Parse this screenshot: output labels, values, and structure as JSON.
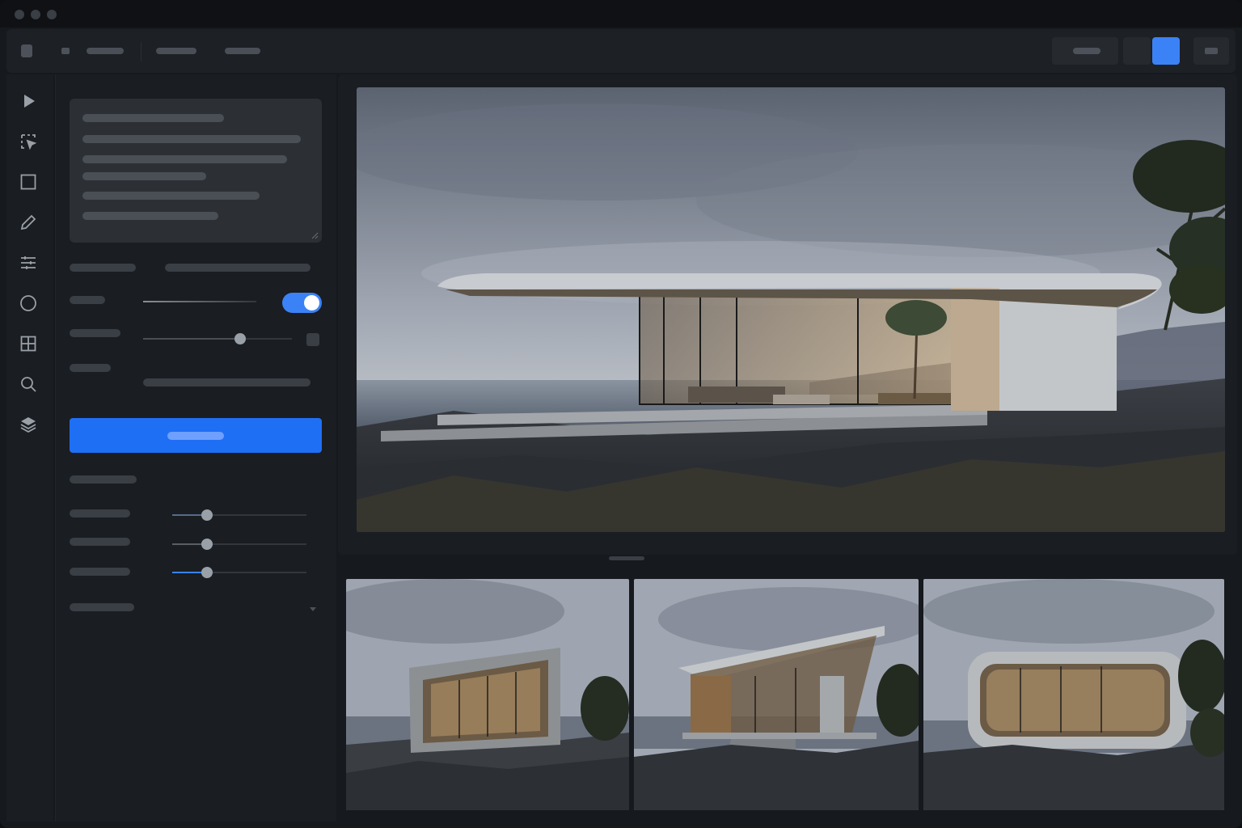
{
  "window": {
    "controls": [
      "window-dot",
      "window-dot",
      "window-dot"
    ]
  },
  "toolbar": {
    "menu": [
      "",
      "",
      ""
    ],
    "buttons": [
      "",
      "",
      ""
    ]
  },
  "rail": {
    "icons": [
      "play-icon",
      "select-icon",
      "rectangle-icon",
      "pen-icon",
      "sliders-icon",
      "circle-icon",
      "grid-icon",
      "search-icon",
      "layers-icon"
    ]
  },
  "panel": {
    "prompt_lines": [
      "",
      "",
      "",
      "",
      "",
      ""
    ],
    "labels": [
      "",
      "",
      "",
      "",
      "",
      "",
      "",
      "",
      "",
      ""
    ],
    "toggle_on": true,
    "sliders": [
      {
        "value": 0.65
      },
      {
        "value": 0.26
      },
      {
        "value": 0.26
      },
      {
        "value": 0.26
      }
    ],
    "generate_label": ""
  },
  "colors": {
    "accent": "#3b82f6",
    "background": "#16191d",
    "panel": "#1a1d21"
  },
  "gallery": {
    "hero": "render-cantilever-house",
    "thumbnails": [
      "render-box-house",
      "render-slanted-roof-house",
      "render-rounded-capsule-house"
    ]
  }
}
